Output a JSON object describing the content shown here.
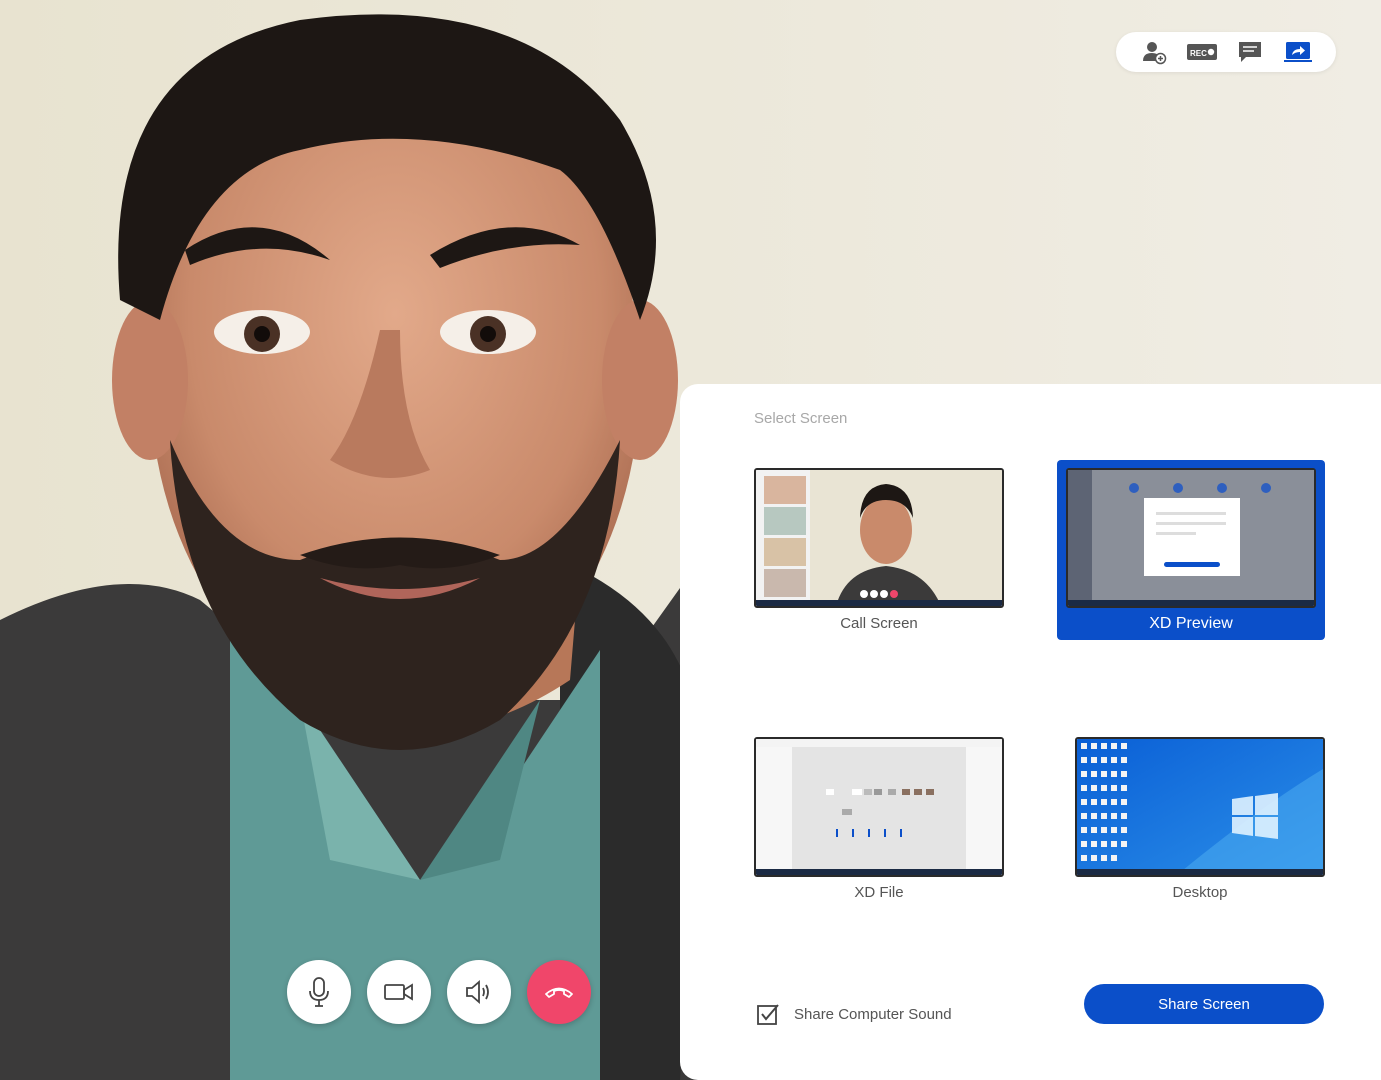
{
  "toolbar": {
    "items": [
      {
        "icon": "add-participant-icon"
      },
      {
        "icon": "record-icon",
        "text": "REC"
      },
      {
        "icon": "chat-icon"
      },
      {
        "icon": "share-screen-icon",
        "active": true
      }
    ]
  },
  "controls": [
    {
      "icon": "microphone-icon"
    },
    {
      "icon": "video-camera-icon"
    },
    {
      "icon": "speaker-icon"
    },
    {
      "icon": "end-call-icon"
    }
  ],
  "share_panel": {
    "title": "Select Screen",
    "screens": [
      {
        "label": "Call Screen",
        "selected": false
      },
      {
        "label": "XD Preview",
        "selected": true
      },
      {
        "label": "XD File",
        "selected": false
      },
      {
        "label": "Desktop",
        "selected": false
      }
    ],
    "share_sound": {
      "label": "Share Computer Sound",
      "checked": true
    },
    "share_button": "Share Screen"
  },
  "colors": {
    "accent": "#0b4fc9",
    "end_call": "#f0466a",
    "panel_bg": "#ffffff",
    "muted_text": "#a8a8a8"
  }
}
